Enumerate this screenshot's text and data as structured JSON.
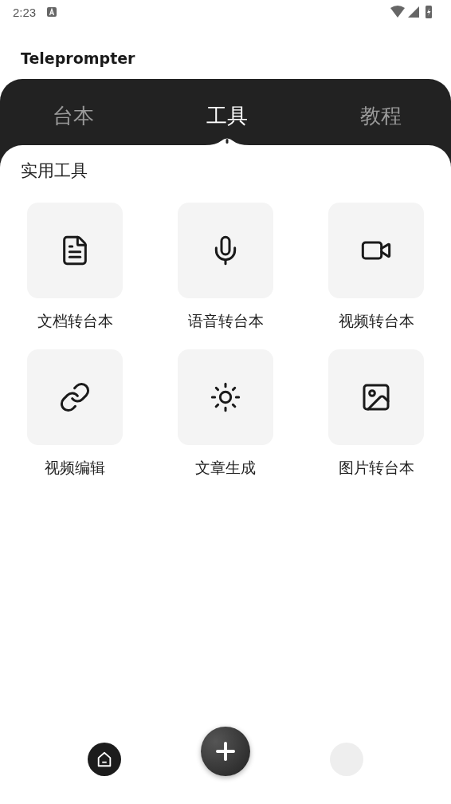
{
  "status_bar": {
    "time": "2:23"
  },
  "app_bar": {
    "title": "Teleprompter"
  },
  "tabs": [
    {
      "label": "台本",
      "selected": false
    },
    {
      "label": "工具",
      "selected": true
    },
    {
      "label": "教程",
      "selected": false
    }
  ],
  "section": {
    "title": "实用工具"
  },
  "tools": [
    {
      "kind": "document",
      "label": "文档转台本"
    },
    {
      "kind": "microphone",
      "label": "语音转台本"
    },
    {
      "kind": "video",
      "label": "视频转台本"
    },
    {
      "kind": "link",
      "label": "视频编辑"
    },
    {
      "kind": "sun",
      "label": "文章生成"
    },
    {
      "kind": "image",
      "label": "图片转台本"
    }
  ],
  "bottom_nav": [
    {
      "kind": "home"
    },
    {
      "kind": "add"
    },
    {
      "kind": "blank"
    }
  ]
}
